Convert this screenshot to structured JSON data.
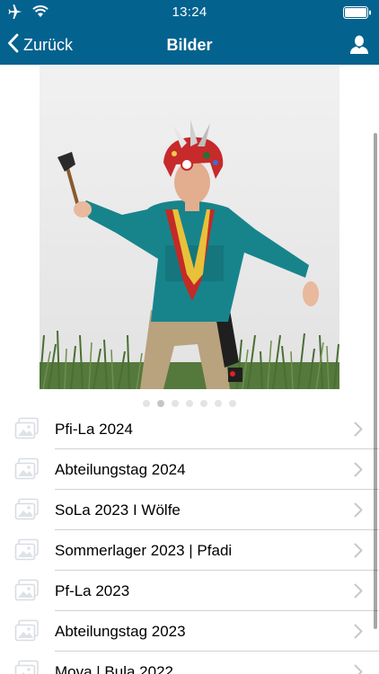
{
  "status_bar": {
    "time": "13:24",
    "icons": [
      "airplane-icon",
      "wifi-icon",
      "battery-icon"
    ]
  },
  "nav": {
    "back_label": "Zurück",
    "title": "Bilder",
    "right_icon": "user-icon"
  },
  "colors": {
    "nav_background": "#04628f",
    "text": "#000000",
    "chevron": "#c7c7cc",
    "divider": "#d2d2d2"
  },
  "carousel": {
    "page_count": 7,
    "active_index": 1
  },
  "albums": [
    {
      "label": "Pfi-La 2024",
      "icon": "photo-album-icon"
    },
    {
      "label": "Abteilungstag 2024",
      "icon": "photo-album-icon"
    },
    {
      "label": "SoLa 2023 I Wölfe",
      "icon": "photo-album-icon"
    },
    {
      "label": "Sommerlager 2023 | Pfadi",
      "icon": "photo-album-icon"
    },
    {
      "label": "Pf-La 2023",
      "icon": "photo-album-icon"
    },
    {
      "label": "Abteilungstag 2023",
      "icon": "photo-album-icon"
    },
    {
      "label": "Mova | Bula 2022",
      "icon": "photo-album-icon"
    }
  ]
}
